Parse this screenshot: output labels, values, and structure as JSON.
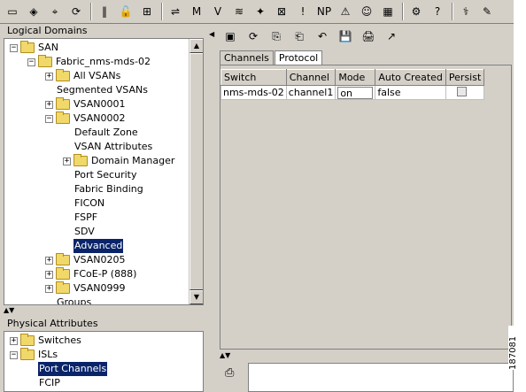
{
  "toolbar": {
    "groups": [
      [
        "folder-open-icon",
        "network-icon",
        "binoculars-icon",
        "refresh-icon"
      ],
      [
        "vertical-bar-icon",
        "lock-icon",
        "tree-icon"
      ],
      [
        "topology-icon",
        "device-manager-icon",
        "fabric-icon",
        "flow-icon",
        "zone-icon",
        "server-icon",
        "info-icon",
        "np-icon",
        "alarm-icon",
        "users-icon",
        "grid-icon"
      ],
      [
        "tools-icon",
        "help-icon"
      ],
      [
        "connect-icon",
        "wizard-icon"
      ]
    ],
    "glyphs": [
      "▭",
      "◈",
      "⌖",
      "⟳",
      "‖",
      "🔓",
      "⊞",
      "⇌",
      "M",
      "V",
      "≋",
      "✦",
      "⊠",
      "!",
      "NP",
      "⚠",
      "☺",
      "▦",
      "⚙",
      "?",
      "⚕",
      "✎"
    ],
    "np_label": "NP"
  },
  "logical_domains": {
    "title": "Logical Domains",
    "items": [
      {
        "label": "SAN",
        "level": 0,
        "expander": "−",
        "folder": true
      },
      {
        "label": "Fabric_nms-mds-02",
        "level": 1,
        "expander": "−",
        "folder": true
      },
      {
        "label": "All VSANs",
        "level": 2,
        "expander": "+",
        "folder": true
      },
      {
        "label": "Segmented VSANs",
        "level": 2,
        "expander": "",
        "folder": false
      },
      {
        "label": "VSAN0001",
        "level": 2,
        "expander": "+",
        "folder": true
      },
      {
        "label": "VSAN0002",
        "level": 2,
        "expander": "−",
        "folder": true
      },
      {
        "label": "Default Zone",
        "level": 3,
        "expander": "",
        "folder": false
      },
      {
        "label": "VSAN Attributes",
        "level": 3,
        "expander": "",
        "folder": false
      },
      {
        "label": "Domain Manager",
        "level": 3,
        "expander": "+",
        "folder": true
      },
      {
        "label": "Port Security",
        "level": 3,
        "expander": "",
        "folder": false
      },
      {
        "label": "Fabric Binding",
        "level": 3,
        "expander": "",
        "folder": false
      },
      {
        "label": "FICON",
        "level": 3,
        "expander": "",
        "folder": false
      },
      {
        "label": "FSPF",
        "level": 3,
        "expander": "",
        "folder": false
      },
      {
        "label": "SDV",
        "level": 3,
        "expander": "",
        "folder": false
      },
      {
        "label": "Advanced",
        "level": 3,
        "expander": "",
        "folder": false,
        "selected": true
      },
      {
        "label": "VSAN0205",
        "level": 2,
        "expander": "+",
        "folder": true
      },
      {
        "label": "FCoE-P (888)",
        "level": 2,
        "expander": "+",
        "folder": true
      },
      {
        "label": "VSAN0999",
        "level": 2,
        "expander": "+",
        "folder": true
      },
      {
        "label": "Groups",
        "level": 2,
        "expander": "",
        "folder": false
      }
    ]
  },
  "physical_attributes": {
    "title": "Physical Attributes",
    "items": [
      {
        "label": "Switches",
        "level": 0,
        "expander": "+",
        "folder": true
      },
      {
        "label": "ISLs",
        "level": 0,
        "expander": "−",
        "folder": true
      },
      {
        "label": "Port Channels",
        "level": 1,
        "expander": "",
        "folder": false,
        "selected": true
      },
      {
        "label": "FCIP",
        "level": 1,
        "expander": "",
        "folder": false
      }
    ]
  },
  "right_toolbar": {
    "icons": [
      "apply-icon",
      "refresh-icon",
      "copy-icon",
      "paste-icon",
      "undo-icon",
      "save-icon",
      "print-icon",
      "export-icon"
    ],
    "glyphs": [
      "▣",
      "⟳",
      "⎘",
      "⎗",
      "↶",
      "💾",
      "🖨",
      "↗"
    ]
  },
  "tabs": [
    {
      "label": "Channels",
      "active": false
    },
    {
      "label": "Protocol",
      "active": true
    }
  ],
  "table": {
    "columns": [
      "Switch",
      "Channel",
      "Mode",
      "Auto Created",
      "Persist"
    ],
    "rows": [
      {
        "switch": "nms-mds-02",
        "channel": "channel1",
        "mode": "on",
        "auto_created": "false",
        "persist": false
      }
    ]
  },
  "bottom": {
    "icon": "log-icon",
    "icon_glyph": "⎙"
  },
  "figure_id": "187081"
}
